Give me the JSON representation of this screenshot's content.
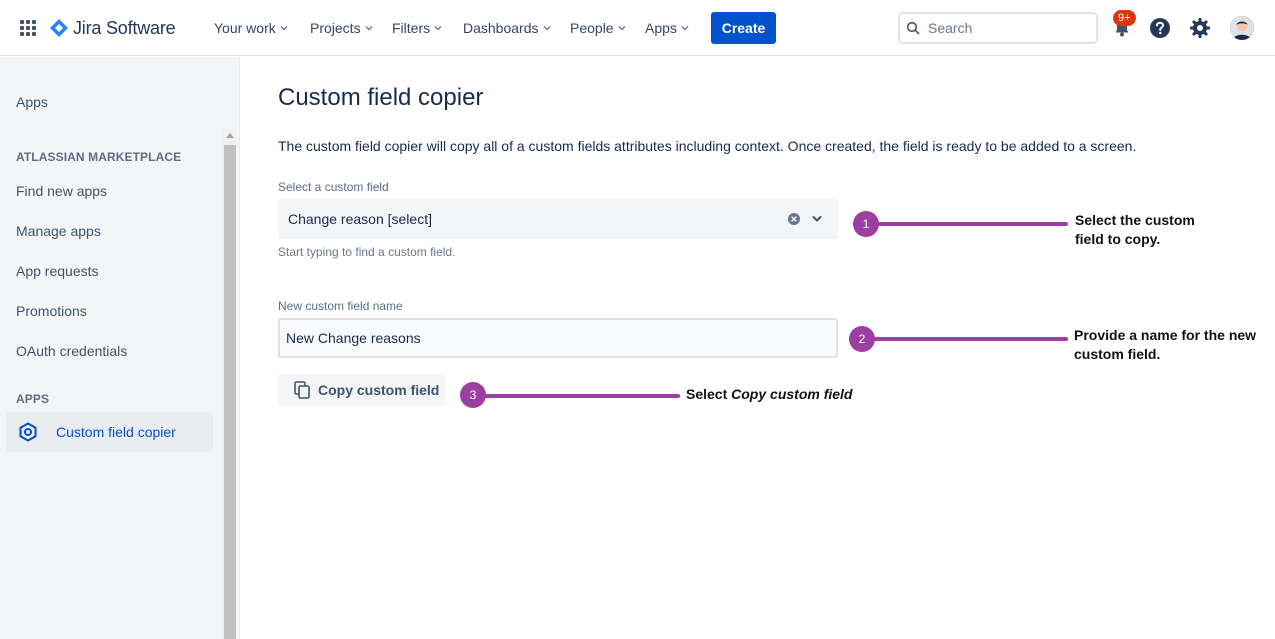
{
  "header": {
    "product_name": "Jira Software",
    "nav": [
      {
        "label": "Your work"
      },
      {
        "label": "Projects"
      },
      {
        "label": "Filters"
      },
      {
        "label": "Dashboards"
      },
      {
        "label": "People"
      },
      {
        "label": "Apps"
      }
    ],
    "create_label": "Create",
    "search_placeholder": "Search",
    "notification_count": "9+",
    "brand_color": "#0052cc"
  },
  "sidebar": {
    "title": "Apps",
    "sections": [
      {
        "heading": "ATLASSIAN MARKETPLACE",
        "items": [
          "Find new apps",
          "Manage apps",
          "App requests",
          "Promotions",
          "OAuth credentials"
        ]
      },
      {
        "heading": "APPS",
        "items": [
          "Custom field copier"
        ]
      }
    ],
    "active_item": "Custom field copier"
  },
  "main": {
    "title": "Custom field copier",
    "description": "The custom field copier will copy all of a custom fields attributes including context. Once created, the field is ready to be added to a screen.",
    "select_label": "Select a custom field",
    "select_value": "Change reason [select]",
    "select_helper": "Start typing to find a custom field.",
    "name_label": "New custom field name",
    "name_value": "New Change reasons",
    "copy_button_label": "Copy custom field"
  },
  "callouts": [
    {
      "number": "1",
      "text_line1": "Select the custom",
      "text_line2": "field to copy."
    },
    {
      "number": "2",
      "text_line1": "Provide a name for the new",
      "text_line2": "custom field."
    },
    {
      "number": "3",
      "text_prefix": "Select ",
      "text_emphasis": "Copy custom field"
    }
  ],
  "colors": {
    "callout": "#9b3fa1",
    "active_text": "#0052cc",
    "badge": "#de350b"
  }
}
